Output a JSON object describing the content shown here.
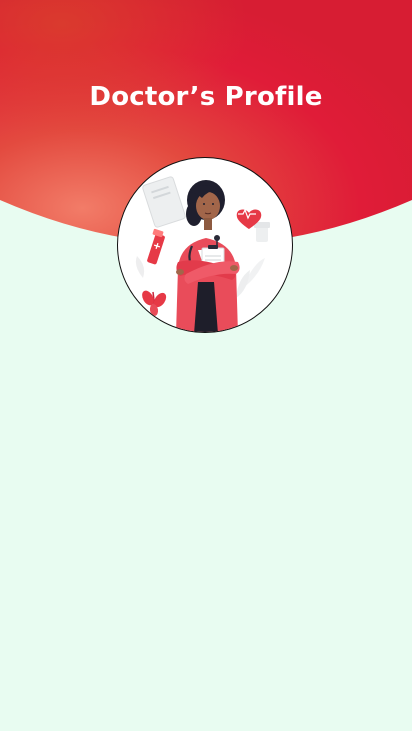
{
  "header": {
    "title": "Doctor’s Profile",
    "gradient_start": "#f0705a",
    "gradient_mid": "#e63a3a",
    "gradient_end": "#e4183a"
  },
  "avatar": {
    "icon": "doctor-illustration-icon",
    "border_color": "#111111"
  },
  "page": {
    "background": "#e8fcf1"
  }
}
